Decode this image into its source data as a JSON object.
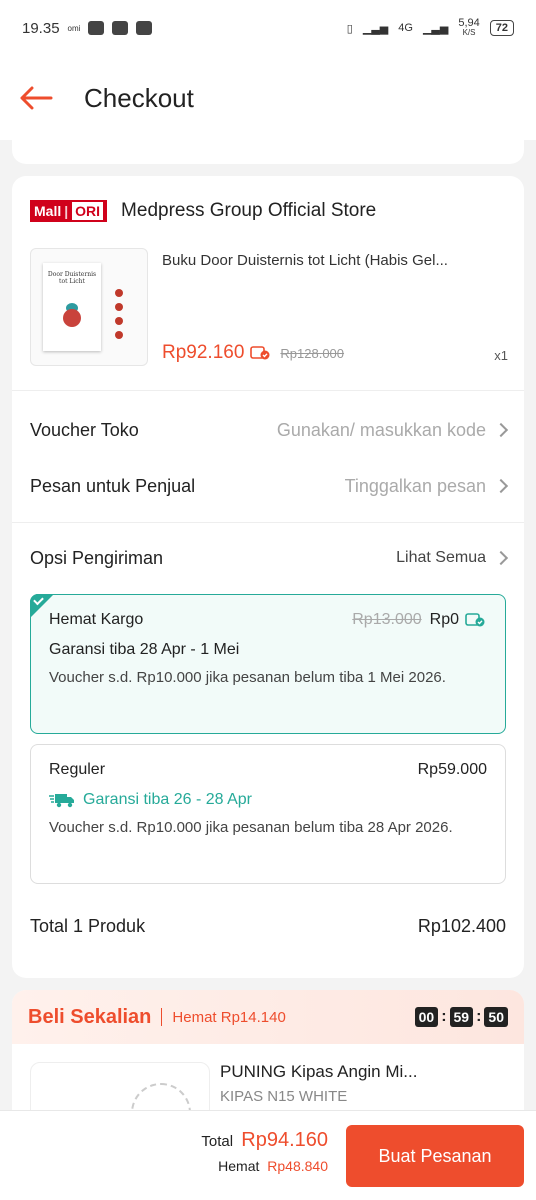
{
  "status_bar": {
    "time": "19.35",
    "omi": "omi",
    "network_type": "4G",
    "speed_value": "5,94",
    "speed_unit": "K/S",
    "battery": "72"
  },
  "header": {
    "title": "Checkout"
  },
  "store": {
    "badge_mall": "Mall",
    "badge_ori": "ORI",
    "name": "Medpress Group Official Store"
  },
  "product": {
    "title": "Buku Door Duisternis tot Licht (Habis Gel...",
    "price": "Rp92.160",
    "original_price": "Rp128.000",
    "quantity": "x1",
    "book_cover_title": "Door Duisternis tot Licht"
  },
  "voucher": {
    "label": "Voucher Toko",
    "placeholder": "Gunakan/ masukkan kode"
  },
  "message": {
    "label": "Pesan untuk Penjual",
    "placeholder": "Tinggalkan pesan"
  },
  "shipping": {
    "label": "Opsi Pengiriman",
    "see_all": "Lihat Semua",
    "options": [
      {
        "name": "Hemat Kargo",
        "original_price": "Rp13.000",
        "price": "Rp0",
        "guarantee": "Garansi tiba 28 Apr - 1 Mei",
        "note": "Voucher s.d. Rp10.000 jika pesanan belum tiba 1 Mei 2026.",
        "selected": true
      },
      {
        "name": "Reguler",
        "price": "Rp59.000",
        "guarantee": "Garansi tiba 26 - 28 Apr",
        "note": "Voucher s.d. Rp10.000 jika pesanan belum tiba 28 Apr 2026.",
        "selected": false
      }
    ]
  },
  "order_total": {
    "label": "Total 1 Produk",
    "value": "Rp102.400"
  },
  "beli_sekalian": {
    "title": "Beli Sekalian",
    "hemat": "Hemat Rp14.140",
    "timer": [
      "00",
      "59",
      "50"
    ],
    "product_name": "PUNING Kipas Angin Mi...",
    "variant": "KIPAS N15 WHITE"
  },
  "footer": {
    "total_label": "Total",
    "total_value": "Rp94.160",
    "hemat_label": "Hemat",
    "hemat_value": "Rp48.840",
    "button": "Buat Pesanan"
  },
  "colors": {
    "accent": "#ee4d2d",
    "teal": "#26aa99",
    "mall_red": "#d0011b"
  }
}
